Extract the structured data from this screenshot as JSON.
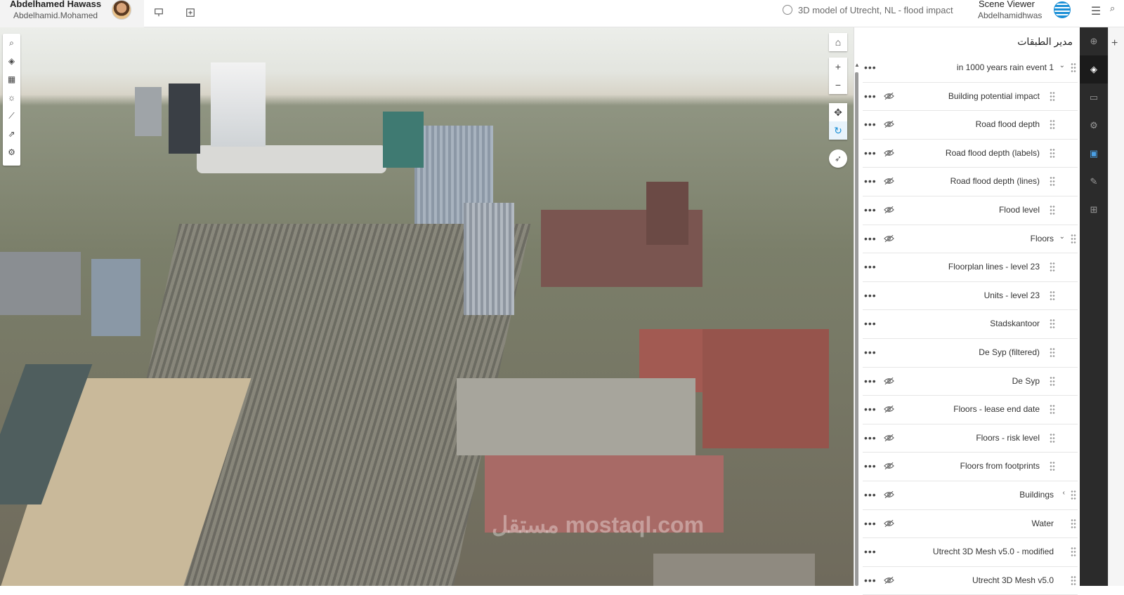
{
  "header": {
    "user_name": "Abdelhamed Hawass",
    "user_handle": "Abdelhamid.Mohamed",
    "scene_title": "3D model of Utrecht, NL - flood impact",
    "app_name": "Scene Viewer",
    "app_user": "Abdelhamidhwas",
    "icons": [
      "presentation-icon",
      "add-slide-icon",
      "globe-icon",
      "app-logo-icon",
      "hamburger-icon",
      "search-icon"
    ]
  },
  "map": {
    "left_tools": [
      "search-icon",
      "layers-icon",
      "basemap-icon",
      "daylight-icon",
      "measure-icon",
      "share-icon",
      "settings-icon"
    ],
    "right_tools": [
      "home-icon",
      "zoom-in-icon",
      "zoom-out-icon",
      "pan-icon",
      "rotate-icon",
      "compass-icon"
    ],
    "watermark": "مستقل mostaql.com"
  },
  "panel": {
    "title": "مدير الطبقات",
    "layers": [
      {
        "label": "in 1000 years rain event 1",
        "expandable": true,
        "chevron": "down",
        "hidden_icon": false,
        "top": true
      },
      {
        "label": "Building potential impact",
        "hidden_icon": true
      },
      {
        "label": "Road flood depth",
        "hidden_icon": true
      },
      {
        "label": "Road flood depth (labels)",
        "hidden_icon": true
      },
      {
        "label": "Road flood depth (lines)",
        "hidden_icon": true
      },
      {
        "label": "Flood level",
        "hidden_icon": true
      },
      {
        "label": "Floors",
        "expandable": true,
        "chevron": "down",
        "hidden_icon": true
      },
      {
        "label": "Floorplan lines - level 23",
        "hidden_icon": false
      },
      {
        "label": "Units - level 23",
        "hidden_icon": false
      },
      {
        "label": "Stadskantoor",
        "hidden_icon": false
      },
      {
        "label": "De Syp (filtered)",
        "hidden_icon": false
      },
      {
        "label": "De Syp",
        "hidden_icon": true
      },
      {
        "label": "Floors - lease end date",
        "hidden_icon": true
      },
      {
        "label": "Floors - risk level",
        "hidden_icon": true
      },
      {
        "label": "Floors from footprints",
        "hidden_icon": true
      },
      {
        "label": "Buildings",
        "expandable": true,
        "chevron": "left",
        "hidden_icon": true
      },
      {
        "label": "Water",
        "expandable": true,
        "chevron": "",
        "hidden_icon": true
      },
      {
        "label": "Utrecht 3D Mesh v5.0 - modified",
        "expandable": true,
        "chevron": "",
        "hidden_icon": false
      },
      {
        "label": "Utrecht 3D Mesh v5.0",
        "expandable": true,
        "chevron": "",
        "hidden_icon": true
      }
    ]
  },
  "sidebar": {
    "items": [
      "add-icon",
      "layers-icon",
      "slides-icon",
      "settings-icon",
      "save-icon",
      "edit-icon",
      "grid-icon"
    ]
  },
  "colors": {
    "accent": "#4aa0e6",
    "sidebar_bg": "#2b2b2b"
  }
}
